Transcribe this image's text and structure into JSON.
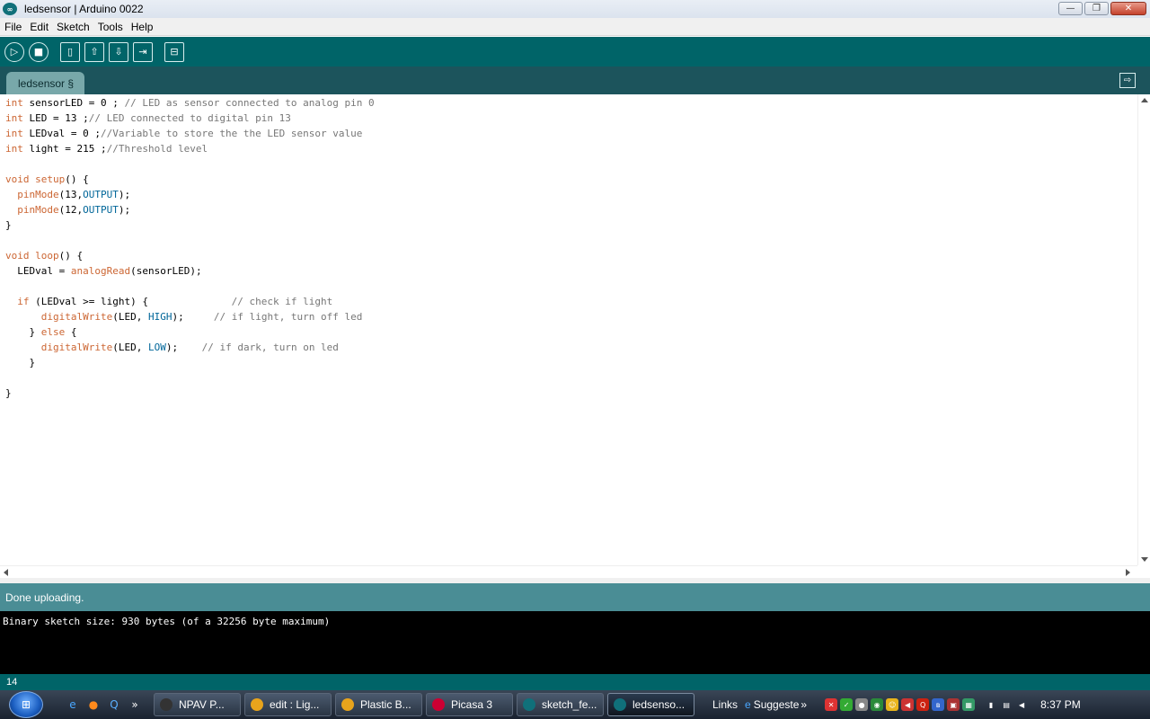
{
  "window": {
    "title": "ledsensor | Arduino 0022",
    "minimize": "—",
    "maximize": "❐",
    "close": "✕"
  },
  "menu": [
    "File",
    "Edit",
    "Sketch",
    "Tools",
    "Help"
  ],
  "toolbar": {
    "icons": [
      "verify-icon",
      "stop-icon",
      "new-icon",
      "open-icon",
      "save-icon",
      "upload-icon",
      "serial-monitor-icon"
    ]
  },
  "tabs": {
    "active": "ledsensor §"
  },
  "code": [
    [
      [
        "kw",
        "int"
      ],
      [
        "t",
        " sensorLED = 0 ; "
      ],
      [
        "cm",
        "// LED as sensor connected to analog pin 0"
      ]
    ],
    [
      [
        "kw",
        "int"
      ],
      [
        "t",
        " LED = 13 ;"
      ],
      [
        "cm",
        "// LED connected to digital pin 13"
      ]
    ],
    [
      [
        "kw",
        "int"
      ],
      [
        "t",
        " LEDval = 0 ;"
      ],
      [
        "cm",
        "//Variable to store the the LED sensor value"
      ]
    ],
    [
      [
        "kw",
        "int"
      ],
      [
        "t",
        " light = 215 ;"
      ],
      [
        "cm",
        "//Threshold level"
      ]
    ],
    [],
    [
      [
        "kw",
        "void"
      ],
      [
        "t",
        " "
      ],
      [
        "fn",
        "setup"
      ],
      [
        "t",
        "() {"
      ]
    ],
    [
      [
        "t",
        "  "
      ],
      [
        "fn",
        "pinMode"
      ],
      [
        "t",
        "(13,"
      ],
      [
        "cst",
        "OUTPUT"
      ],
      [
        "t",
        ");"
      ]
    ],
    [
      [
        "t",
        "  "
      ],
      [
        "fn",
        "pinMode"
      ],
      [
        "t",
        "(12,"
      ],
      [
        "cst",
        "OUTPUT"
      ],
      [
        "t",
        ");"
      ]
    ],
    [
      [
        "t",
        "}"
      ]
    ],
    [],
    [
      [
        "kw",
        "void"
      ],
      [
        "t",
        " "
      ],
      [
        "fn",
        "loop"
      ],
      [
        "t",
        "() {"
      ]
    ],
    [
      [
        "t",
        "  LEDval = "
      ],
      [
        "fn",
        "analogRead"
      ],
      [
        "t",
        "(sensorLED);"
      ]
    ],
    [],
    [
      [
        "t",
        "  "
      ],
      [
        "kw",
        "if"
      ],
      [
        "t",
        " (LEDval >= light) {              "
      ],
      [
        "cm",
        "// check if light"
      ]
    ],
    [
      [
        "t",
        "      "
      ],
      [
        "fn",
        "digitalWrite"
      ],
      [
        "t",
        "(LED, "
      ],
      [
        "cst",
        "HIGH"
      ],
      [
        "t",
        ");     "
      ],
      [
        "cm",
        "// if light, turn off led"
      ]
    ],
    [
      [
        "t",
        "    } "
      ],
      [
        "kw",
        "else"
      ],
      [
        "t",
        " {"
      ]
    ],
    [
      [
        "t",
        "      "
      ],
      [
        "fn",
        "digitalWrite"
      ],
      [
        "t",
        "(LED, "
      ],
      [
        "cst",
        "LOW"
      ],
      [
        "t",
        ");    "
      ],
      [
        "cm",
        "// if dark, turn on led"
      ]
    ],
    [
      [
        "t",
        "    }"
      ]
    ],
    [],
    [
      [
        "t",
        "}"
      ]
    ]
  ],
  "status": {
    "message": "Done uploading.",
    "console": "Binary sketch size: 930 bytes (of a 32256 byte maximum)",
    "line_number": "14"
  },
  "taskbar": {
    "quick_launch": [
      "ie-icon",
      "firefox-icon",
      "search-icon",
      "more-icon"
    ],
    "quick_launch_more": "»",
    "tasks": [
      {
        "label": "NPAV P...",
        "icon": "search-icon",
        "active": false,
        "color": "#333"
      },
      {
        "label": "edit : Lig...",
        "icon": "chrome-icon",
        "active": false,
        "color": "#e8a41c"
      },
      {
        "label": "Plastic B...",
        "icon": "chrome-icon",
        "active": false,
        "color": "#e8a41c"
      },
      {
        "label": "Picasa 3",
        "icon": "picasa-icon",
        "active": false,
        "color": "#c03"
      },
      {
        "label": "sketch_fe...",
        "icon": "arduino-icon",
        "active": false,
        "color": "#10707a"
      },
      {
        "label": "ledsenso...",
        "icon": "arduino-icon",
        "active": true,
        "color": "#10707a"
      }
    ],
    "links_label": "Links",
    "suggested_label": "Suggeste",
    "links_more": "»",
    "clock": "8:37 PM"
  },
  "colors": {
    "toolbar": "#006468",
    "tabbar": "#1c545c",
    "status": "#4a8d95",
    "keyword": "#cc6633",
    "constant": "#006699",
    "comment": "#777777"
  }
}
